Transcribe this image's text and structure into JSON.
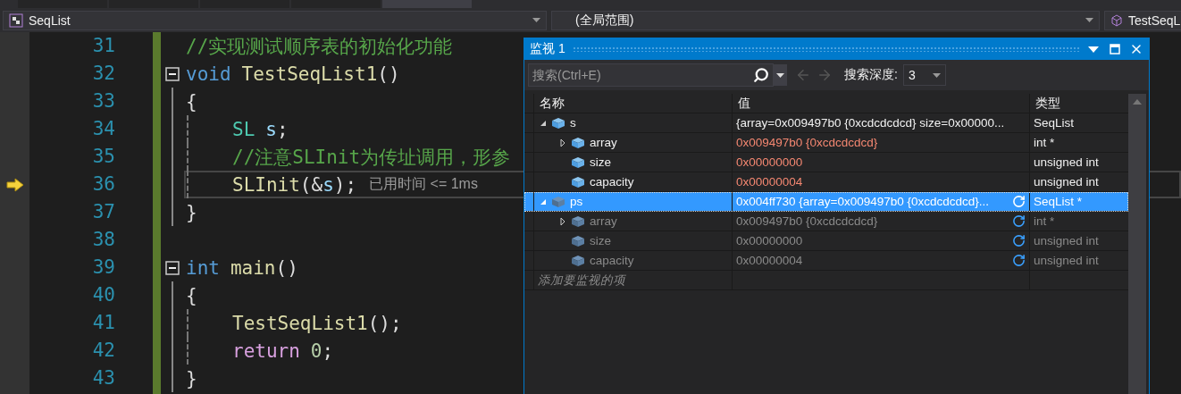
{
  "tab_strip": {
    "tabs": [
      {
        "selected": false
      },
      {
        "selected": false
      },
      {
        "selected": false
      },
      {
        "selected": false
      },
      {
        "selected": true
      }
    ]
  },
  "nav_bar": {
    "project": "SeqList",
    "scope": "(全局范围)",
    "member": "TestSeqL"
  },
  "code_lines": [
    {
      "number": "31",
      "fold": false,
      "in_block": false,
      "indented": false,
      "current": false,
      "tokens": [
        {
          "kind": "comment",
          "text": "//实现测试顺序表的初始化功能"
        }
      ]
    },
    {
      "number": "32",
      "fold": true,
      "in_block": false,
      "indented": false,
      "current": false,
      "tokens": [
        {
          "kind": "keyword",
          "text": "void"
        },
        {
          "kind": "func",
          "text": "TestSeqList1"
        },
        {
          "kind": "plain",
          "text": "()"
        }
      ]
    },
    {
      "number": "33",
      "fold": false,
      "in_block": true,
      "indented": false,
      "current": false,
      "tokens": [
        {
          "kind": "plain",
          "text": "{"
        }
      ]
    },
    {
      "number": "34",
      "fold": false,
      "in_block": true,
      "indented": true,
      "current": false,
      "tokens": [
        {
          "kind": "type",
          "text": "SL"
        },
        {
          "kind": "var",
          "text": "s"
        },
        {
          "kind": "plain",
          "text": ";"
        }
      ]
    },
    {
      "number": "35",
      "fold": false,
      "in_block": true,
      "indented": true,
      "current": false,
      "tokens": [
        {
          "kind": "comment",
          "text": "//注意SLInit为传址调用，形参"
        }
      ]
    },
    {
      "number": "36",
      "fold": false,
      "in_block": true,
      "indented": true,
      "current": true,
      "tokens": [
        {
          "kind": "func",
          "text": "SLInit"
        },
        {
          "kind": "plain",
          "text": "(&"
        },
        {
          "kind": "var",
          "text": "s"
        },
        {
          "kind": "plain",
          "text": ");"
        },
        {
          "kind": "hint",
          "text": "已用时间 <= 1ms"
        }
      ]
    },
    {
      "number": "37",
      "fold": false,
      "in_block": true,
      "indented": false,
      "current": false,
      "tokens": [
        {
          "kind": "plain",
          "text": "}"
        }
      ]
    },
    {
      "number": "38",
      "fold": false,
      "in_block": false,
      "indented": false,
      "current": false
    },
    {
      "number": "39",
      "fold": true,
      "in_block": false,
      "indented": false,
      "current": false,
      "tokens": [
        {
          "kind": "keyword",
          "text": "int"
        },
        {
          "kind": "func",
          "text": "main"
        },
        {
          "kind": "plain",
          "text": "()"
        }
      ]
    },
    {
      "number": "40",
      "fold": false,
      "in_block": true,
      "indented": false,
      "current": false,
      "tokens": [
        {
          "kind": "plain",
          "text": "{"
        }
      ]
    },
    {
      "number": "41",
      "fold": false,
      "in_block": true,
      "indented": true,
      "current": false,
      "tokens": [
        {
          "kind": "func",
          "text": "TestSeqList1"
        },
        {
          "kind": "plain",
          "text": "();"
        }
      ]
    },
    {
      "number": "42",
      "fold": false,
      "in_block": true,
      "indented": true,
      "current": false,
      "tokens": [
        {
          "kind": "control",
          "text": "return"
        },
        {
          "kind": "number",
          "text": "0"
        },
        {
          "kind": "plain",
          "text": ";"
        }
      ]
    },
    {
      "number": "43",
      "fold": false,
      "in_block": true,
      "indented": false,
      "current": false,
      "tokens": [
        {
          "kind": "plain",
          "text": "}"
        }
      ]
    }
  ],
  "watch": {
    "title": "监视 1",
    "search": {
      "placeholder": "搜索(Ctrl+E)"
    },
    "depth_label": "搜索深度:",
    "depth": "3",
    "columns": [
      "名称",
      "值",
      "类型"
    ],
    "rows": [
      {
        "name": "s",
        "value": "{array=0x009497b0 {0xcdcdcdcd} size=0x00000...",
        "type": "SeqList",
        "expanded": true,
        "selected": false,
        "changed": false,
        "stale": false,
        "children": [
          {
            "name": "array",
            "value": "0x009497b0 {0xcdcdcdcd}",
            "type": "int *",
            "expanded": false,
            "selected": false,
            "changed": true,
            "stale": false
          },
          {
            "name": "size",
            "value": "0x00000000",
            "type": "unsigned int",
            "selected": false,
            "changed": true,
            "stale": false
          },
          {
            "name": "capacity",
            "value": "0x00000004",
            "type": "unsigned int",
            "selected": false,
            "changed": true,
            "stale": false
          }
        ]
      },
      {
        "name": "ps",
        "value": "0x004ff730 {array=0x009497b0 {0xcdcdcdcd}...",
        "type": "SeqList *",
        "expanded": true,
        "selected": true,
        "changed": false,
        "stale": true,
        "children": [
          {
            "name": "array",
            "value": "0x009497b0 {0xcdcdcdcd}",
            "type": "int *",
            "expanded": false,
            "selected": false,
            "changed": false,
            "stale": true
          },
          {
            "name": "size",
            "value": "0x00000000",
            "type": "unsigned int",
            "selected": false,
            "changed": false,
            "stale": true
          },
          {
            "name": "capacity",
            "value": "0x00000004",
            "type": "unsigned int",
            "selected": false,
            "changed": false,
            "stale": true
          }
        ]
      }
    ],
    "add_placeholder": "添加要监视的项"
  }
}
